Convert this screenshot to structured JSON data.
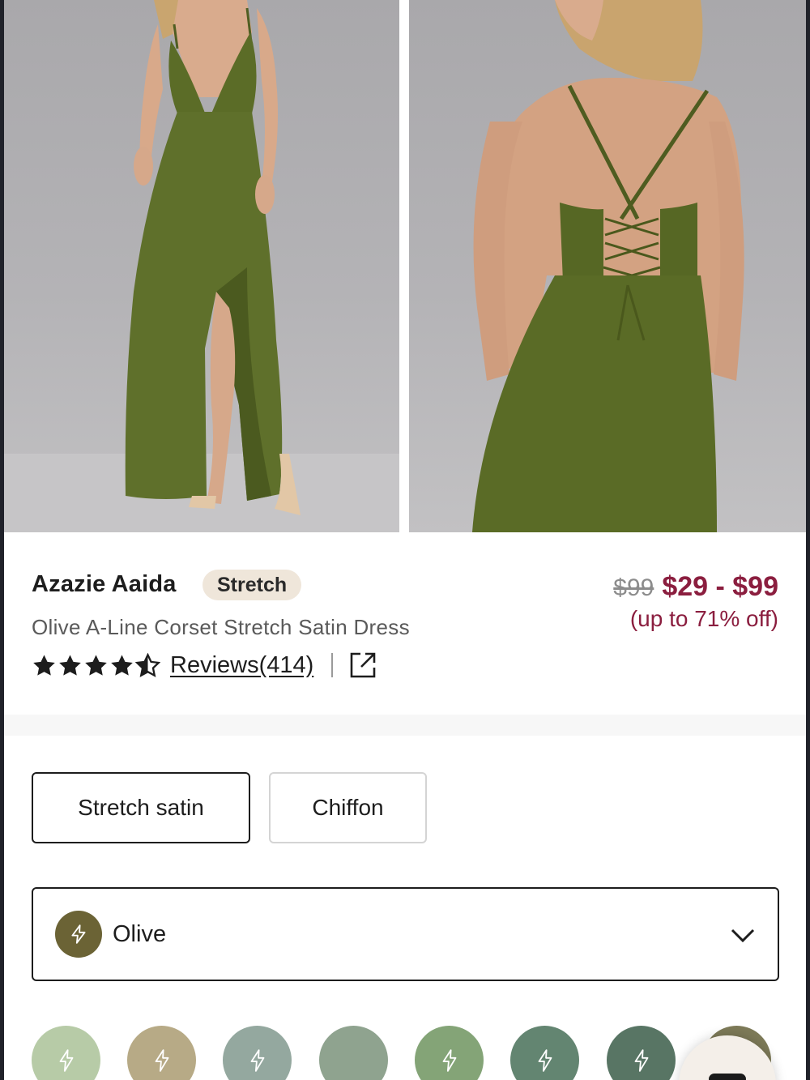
{
  "product": {
    "brand": "Azazie Aaida",
    "badge": "Stretch",
    "subtitle": "Olive A-Line Corset Stretch Satin Dress",
    "rating": 4.5,
    "reviews_label": "Reviews(414)",
    "original_price": "$99",
    "sale_price": "$29 - $99",
    "discount_text": "(up to 71% off)"
  },
  "images": [
    {
      "name": "front-view",
      "icon": "dress-front-photo"
    },
    {
      "name": "back-view",
      "icon": "dress-back-photo"
    }
  ],
  "fabric_options": [
    {
      "label": "Stretch satin",
      "selected": true
    },
    {
      "label": "Chiffon",
      "selected": false
    }
  ],
  "color_selector": {
    "selected_label": "Olive",
    "selected_color": "#6b6335",
    "icon": "lightning-icon",
    "dropdown_icon": "chevron-down-icon"
  },
  "color_swatches": [
    {
      "color": "#b7cba7",
      "icon": "lightning-icon"
    },
    {
      "color": "#b7aa86",
      "icon": "lightning-icon"
    },
    {
      "color": "#94a89f",
      "icon": "lightning-icon"
    },
    {
      "color": "#8fa38f",
      "icon": "none"
    },
    {
      "color": "#84a477",
      "icon": "lightning-icon"
    },
    {
      "color": "#638571",
      "icon": "lightning-icon"
    },
    {
      "color": "#587564",
      "icon": "lightning-icon"
    },
    {
      "color": "#7d7a58",
      "icon": "none"
    }
  ],
  "colors": {
    "sale": "#8b1e3f",
    "badge_bg": "#efe6da",
    "dress": "#5d6e2a"
  }
}
